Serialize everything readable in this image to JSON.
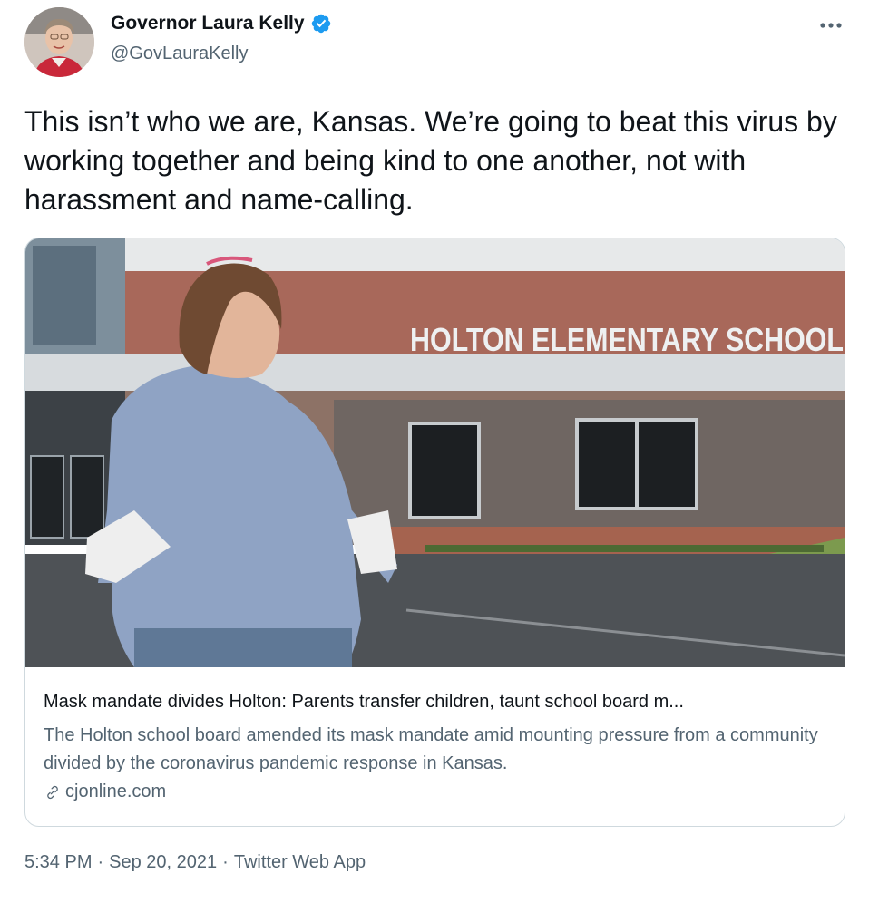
{
  "author": {
    "display_name": "Governor Laura Kelly",
    "handle": "@GovLauraKelly",
    "verified": true,
    "avatar_icon": "avatar-photo"
  },
  "more_icon": "more-horizontal-icon",
  "tweet": {
    "text": "This isn’t who we are, Kansas. We’re going to beat this virus by working together and being kind to one another, not with harassment and name-calling."
  },
  "card": {
    "image_sign_text": "HOLTON ELEMENTARY SCHOOL",
    "title": "Mask mandate divides Holton: Parents transfer children, taunt school board m...",
    "description": "The Holton school board amended its mask mandate amid mounting pressure from a community divided by the coronavirus pandemic response in Kansas.",
    "domain": "cjonline.com",
    "domain_icon": "link-icon"
  },
  "meta": {
    "time": "5:34 PM",
    "separator": "·",
    "date": "Sep 20, 2021",
    "source": "Twitter Web App"
  },
  "colors": {
    "text_primary": "#0f1419",
    "text_secondary": "#536471",
    "verified_blue": "#1d9bf0",
    "border": "#cfd9de"
  }
}
